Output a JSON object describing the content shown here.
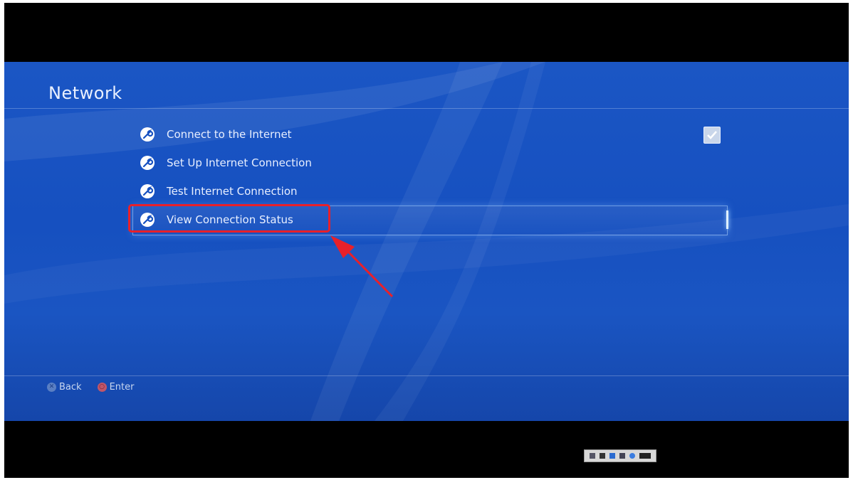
{
  "screen": {
    "title": "Network",
    "menu": [
      {
        "label": "Connect to the Internet",
        "icon": "wrench-icon",
        "checked": true
      },
      {
        "label": "Set Up Internet Connection",
        "icon": "wrench-icon"
      },
      {
        "label": "Test Internet Connection",
        "icon": "wrench-icon"
      },
      {
        "label": "View Connection Status",
        "icon": "wrench-icon",
        "selected": true
      }
    ],
    "footer": {
      "back_label": "Back",
      "enter_label": "Enter"
    }
  },
  "colors": {
    "background": "#1650c0",
    "annotation": "#e8202a",
    "text": "#e8efff"
  }
}
